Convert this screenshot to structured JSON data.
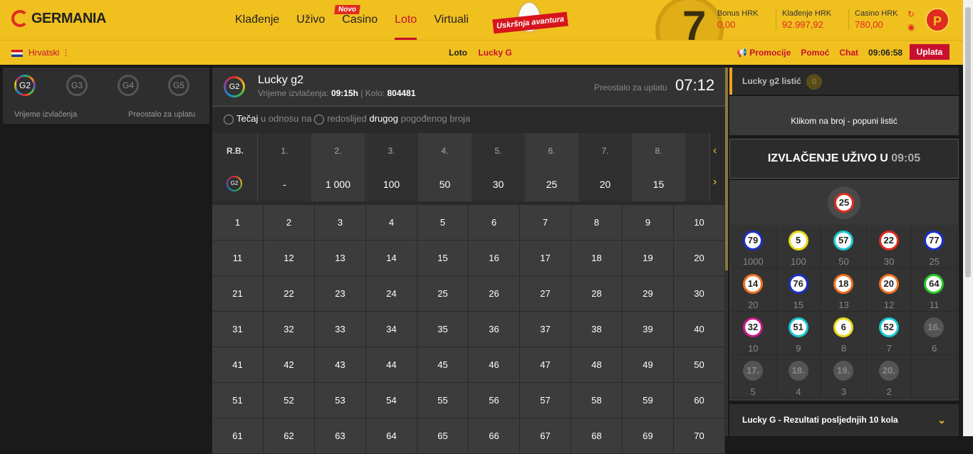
{
  "brand": {
    "name": "GERMANIA"
  },
  "nav": [
    "Klađenje",
    "Uživo",
    "Casino",
    "Loto",
    "Virtuali"
  ],
  "nav_badge": "Novo",
  "promo_banner": "Uskršnja avantura",
  "balances": [
    {
      "label": "Bonus HRK",
      "value": "0,00"
    },
    {
      "label": "Klađenje HRK",
      "value": "92.997,92"
    },
    {
      "label": "Casino HRK",
      "value": "780,00"
    }
  ],
  "profile_initial": "P",
  "subnav": {
    "language": "Hrvatski",
    "breadcrumb": [
      "Loto",
      "Lucky G"
    ],
    "links": [
      "Promocije",
      "Pomoć",
      "Chat"
    ],
    "time": "09:06:58",
    "deposit": "Uplata"
  },
  "left": {
    "games": [
      "G2",
      "G3",
      "G4",
      "G5"
    ],
    "col1": "Vrijeme izvlačenja",
    "col2": "Preostalo za uplatu"
  },
  "game": {
    "icon": "G2",
    "title": "Lucky g2",
    "draw_time_label": "Vrijeme izvlačenja:",
    "draw_time": "09:15h",
    "round_label": "Kolo:",
    "round": "804481",
    "remaining_label": "Preostalo za uplatu",
    "remaining": "07:12",
    "radio1": "Tečaj",
    "radio1_rest": "u odnosu na",
    "radio2": "redoslijed",
    "radio2_bold": "drugog",
    "radio2_rest": "pogođenog broja"
  },
  "paytable": {
    "rb_label": "R.B.",
    "icon": "G2",
    "headers": [
      "1.",
      "2.",
      "3.",
      "4.",
      "5.",
      "6.",
      "7.",
      "8."
    ],
    "values": [
      "-",
      "1 000",
      "100",
      "50",
      "30",
      "25",
      "20",
      "15"
    ]
  },
  "numbers": [
    "1",
    "2",
    "3",
    "4",
    "5",
    "6",
    "7",
    "8",
    "9",
    "10",
    "11",
    "12",
    "13",
    "14",
    "15",
    "16",
    "17",
    "18",
    "19",
    "20",
    "21",
    "22",
    "23",
    "24",
    "25",
    "26",
    "27",
    "28",
    "29",
    "30",
    "31",
    "32",
    "33",
    "34",
    "35",
    "36",
    "37",
    "38",
    "39",
    "40",
    "41",
    "42",
    "43",
    "44",
    "45",
    "46",
    "47",
    "48",
    "49",
    "50",
    "51",
    "52",
    "53",
    "54",
    "55",
    "56",
    "57",
    "58",
    "59",
    "60",
    "61",
    "62",
    "63",
    "64",
    "65",
    "66",
    "67",
    "68",
    "69",
    "70"
  ],
  "slip": {
    "title": "Lucky g2 listić",
    "count": "0",
    "hint": "Klikom na broj - popuni listić"
  },
  "live": {
    "label": "IZVLAČENJE UŽIVO U",
    "time": "09:05",
    "current": {
      "n": "25",
      "color": "#e02b20"
    },
    "draws": [
      {
        "n": "79",
        "sub": "1000",
        "color": "#1a2fc8"
      },
      {
        "n": "5",
        "sub": "100",
        "color": "#e8d81a"
      },
      {
        "n": "57",
        "sub": "50",
        "color": "#1ac8d0"
      },
      {
        "n": "22",
        "sub": "30",
        "color": "#e02b20"
      },
      {
        "n": "77",
        "sub": "25",
        "color": "#1a2fc8"
      },
      {
        "n": "14",
        "sub": "20",
        "color": "#f07020"
      },
      {
        "n": "76",
        "sub": "15",
        "color": "#1a2fc8"
      },
      {
        "n": "18",
        "sub": "13",
        "color": "#f07020"
      },
      {
        "n": "20",
        "sub": "12",
        "color": "#f07020"
      },
      {
        "n": "64",
        "sub": "11",
        "color": "#2ac82a"
      },
      {
        "n": "32",
        "sub": "10",
        "color": "#c81a8a"
      },
      {
        "n": "51",
        "sub": "9",
        "color": "#1ac8d0"
      },
      {
        "n": "6",
        "sub": "8",
        "color": "#e8d81a"
      },
      {
        "n": "52",
        "sub": "7",
        "color": "#1ac8d0"
      },
      {
        "n": "16.",
        "sub": "6",
        "color": "grey"
      },
      {
        "n": "17.",
        "sub": "5",
        "color": "grey"
      },
      {
        "n": "18.",
        "sub": "4",
        "color": "grey"
      },
      {
        "n": "19.",
        "sub": "3",
        "color": "grey"
      },
      {
        "n": "20.",
        "sub": "2",
        "color": "grey"
      }
    ]
  },
  "results": {
    "label": "Lucky G - Rezultati posljednjih 10 kola"
  }
}
